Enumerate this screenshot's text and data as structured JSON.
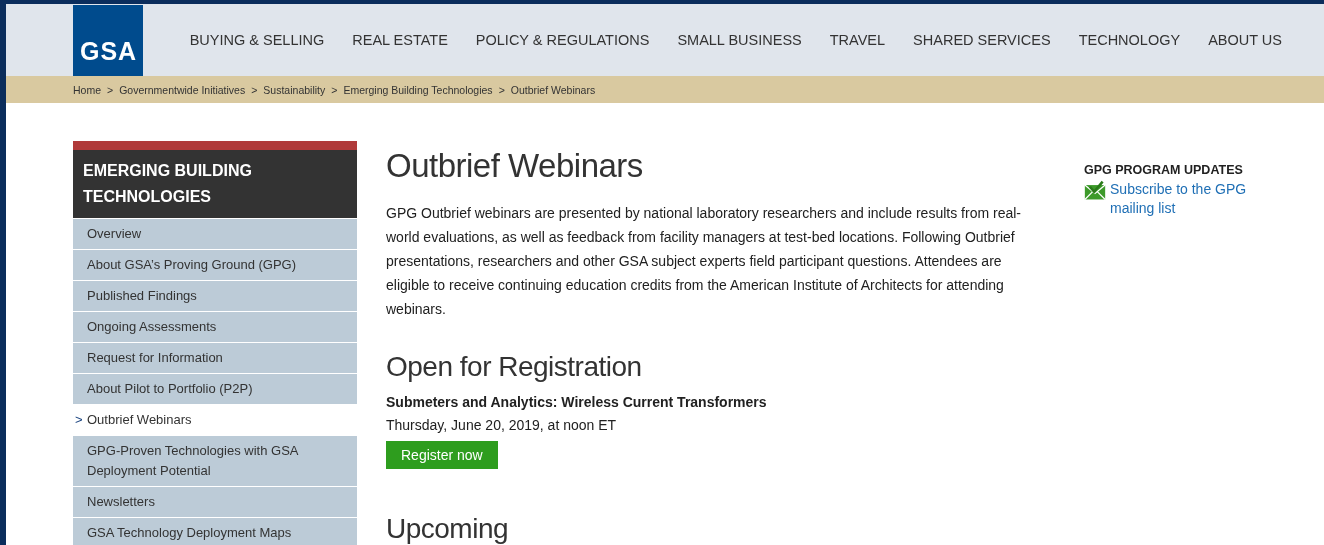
{
  "header": {
    "logo": "GSA",
    "nav": [
      "BUYING & SELLING",
      "REAL ESTATE",
      "POLICY & REGULATIONS",
      "SMALL BUSINESS",
      "TRAVEL",
      "SHARED SERVICES",
      "TECHNOLOGY",
      "ABOUT US"
    ]
  },
  "breadcrumb": {
    "items": [
      "Home",
      "Governmentwide Initiatives",
      "Sustainability",
      "Emerging Building Technologies",
      "Outbrief Webinars"
    ],
    "separator": ">"
  },
  "sidebar": {
    "title": "EMERGING BUILDING TECHNOLOGIES",
    "marker": ">",
    "items": [
      {
        "label": "Overview",
        "selected": false
      },
      {
        "label": "About GSA’s Proving Ground (GPG)",
        "selected": false
      },
      {
        "label": "Published Findings",
        "selected": false
      },
      {
        "label": "Ongoing Assessments",
        "selected": false
      },
      {
        "label": "Request for Information",
        "selected": false
      },
      {
        "label": "About Pilot to Portfolio (P2P)",
        "selected": false
      },
      {
        "label": "Outbrief Webinars",
        "selected": true
      },
      {
        "label": "GPG-Proven Technologies with GSA Deployment Potential",
        "selected": false
      },
      {
        "label": "Newsletters",
        "selected": false
      },
      {
        "label": "GSA Technology Deployment Maps",
        "selected": false
      }
    ]
  },
  "main": {
    "title": "Outbrief Webinars",
    "intro": "GPG Outbrief webinars are presented by national laboratory researchers and include results from real-world evaluations, as well as feedback from facility managers at test-bed locations. Following Outbrief presentations, researchers and other GSA subject experts field participant questions. Attendees are eligible to receive continuing education credits from the American Institute of Architects for attending webinars.",
    "sections": [
      {
        "heading": "Open for Registration",
        "event_title": "Submeters and Analytics: Wireless Current Transformers",
        "event_date": "Thursday, June 20, 2019, at noon ET",
        "button": "Register now"
      },
      {
        "heading": "Upcoming"
      }
    ]
  },
  "aside": {
    "title": "GPG PROGRAM UPDATES",
    "link": "Subscribe to the GPG mailing list"
  }
}
